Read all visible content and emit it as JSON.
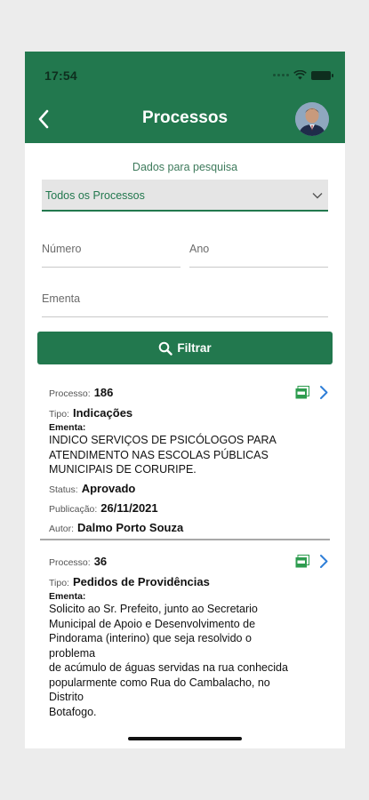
{
  "status_bar": {
    "time": "17:54"
  },
  "header": {
    "title": "Processos"
  },
  "search": {
    "caption": "Dados para pesquisa",
    "select_value": "Todos os Processos",
    "numero_label": "Número",
    "ano_label": "Ano",
    "ementa_label": "Ementa",
    "filter_label": "Filtrar"
  },
  "labels": {
    "processo": "Processo:",
    "tipo": "Tipo:",
    "ementa": "Ementa:",
    "status": "Status:",
    "publicacao": "Publicação:",
    "autor": "Autor:"
  },
  "processes": [
    {
      "numero": "186",
      "tipo": "Indicações",
      "ementa": "INDICO SERVIÇOS DE PSICÓLOGOS PARA\nATENDIMENTO NAS ESCOLAS PÚBLICAS\nMUNICIPAIS DE CORURIPE.",
      "status": "Aprovado",
      "publicacao": "26/11/2021",
      "autor": "Dalmo Porto Souza"
    },
    {
      "numero": "36",
      "tipo": "Pedidos de Providências",
      "ementa": "Solicito ao Sr. Prefeito, junto ao Secretario\nMunicipal de Apoio e Desenvolvimento de\nPindorama (interino) que seja resolvido o\nproblema\nde acúmulo de águas servidas na rua conhecida\npopularmente como Rua do Cambalacho, no\nDistrito\nBotafogo."
    }
  ],
  "colors": {
    "primary": "#22784e",
    "background": "#ffffff",
    "page": "#ececec"
  }
}
